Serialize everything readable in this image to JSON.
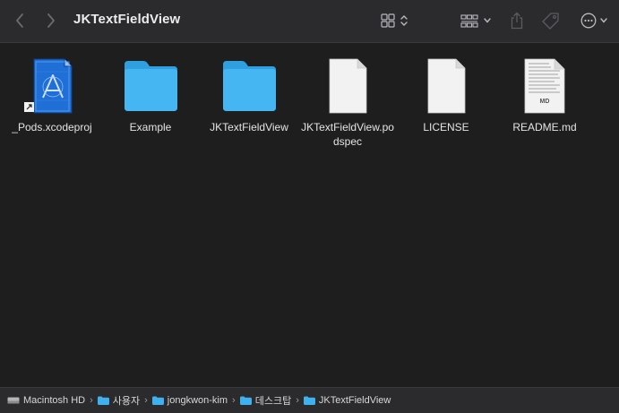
{
  "window": {
    "title": "JKTextFieldView"
  },
  "toolbar": {
    "back_icon": "chevron-left-icon",
    "forward_icon": "chevron-right-icon",
    "view_icon": "grid-view-icon",
    "group_icon": "group-by-icon",
    "share_icon": "share-icon",
    "tag_icon": "tag-icon",
    "more_icon": "ellipsis-circle-icon"
  },
  "files": [
    {
      "name": "_Pods.xcodeproj",
      "kind": "xcodeproj"
    },
    {
      "name": "Example",
      "kind": "folder"
    },
    {
      "name": "JKTextFieldView",
      "kind": "folder"
    },
    {
      "name": "JKTextFieldView.podspec",
      "kind": "document"
    },
    {
      "name": "LICENSE",
      "kind": "document"
    },
    {
      "name": "README.md",
      "kind": "markdown",
      "badge": "MD"
    }
  ],
  "pathbar": {
    "items": [
      {
        "label": "Macintosh HD",
        "icon": "hard-drive-icon"
      },
      {
        "label": "사용자",
        "icon": "folder-icon"
      },
      {
        "label": "jongkwon-kim",
        "icon": "folder-icon"
      },
      {
        "label": "데스크탑",
        "icon": "folder-icon"
      },
      {
        "label": "JKTextFieldView",
        "icon": "folder-icon"
      }
    ],
    "separator": "›"
  },
  "colors": {
    "folder": "#3fb1ef",
    "toolbar_bg": "#2b2a2d",
    "content_bg": "#1e1e1f",
    "xcode_blue": "#1f6fd6"
  }
}
